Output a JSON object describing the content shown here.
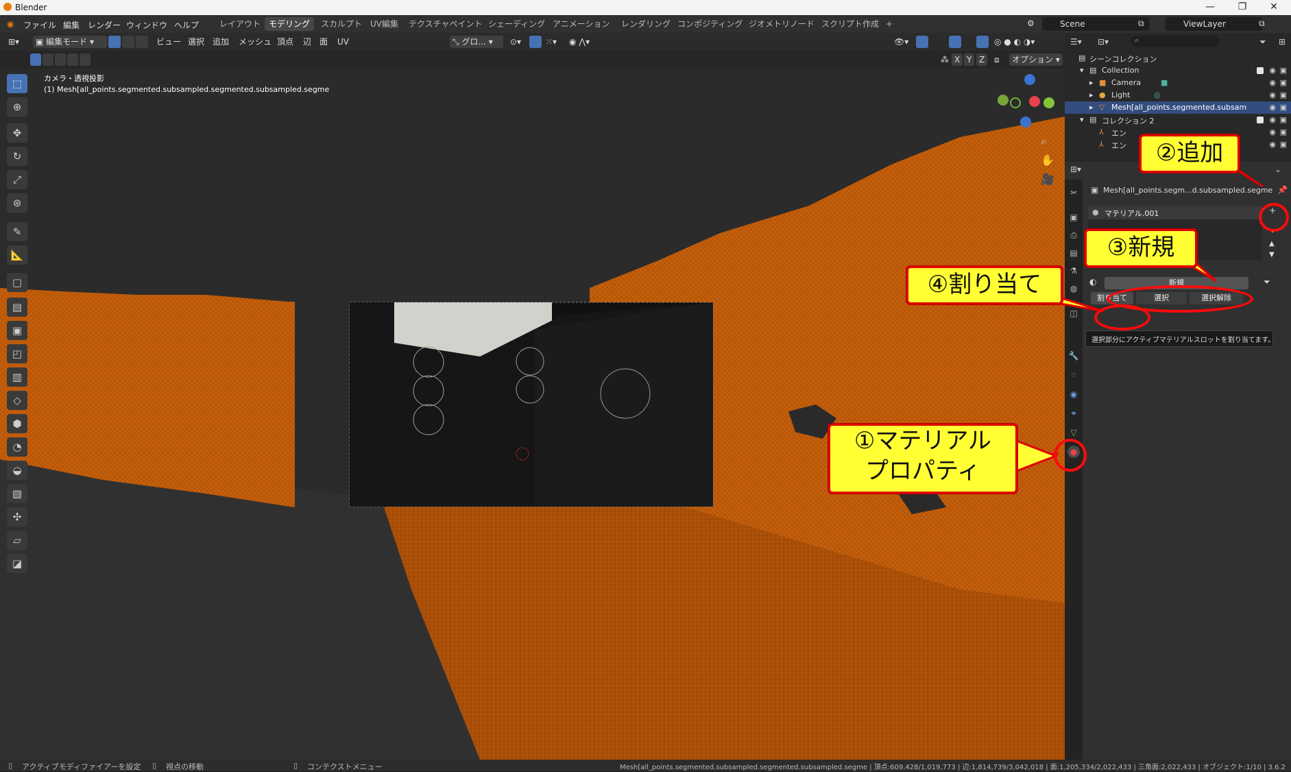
{
  "window": {
    "title": "Blender",
    "controls": [
      "—",
      "❐",
      "✕"
    ]
  },
  "menus": [
    "ファイル",
    "編集",
    "レンダー",
    "ウィンドウ",
    "ヘルプ"
  ],
  "workspaces": [
    "レイアウト",
    "モデリング",
    "スカルプト",
    "UV編集",
    "テクスチャペイント",
    "シェーディング",
    "アニメーション",
    "レンダリング",
    "コンポジティング",
    "ジオメトリノード",
    "スクリプト作成",
    "+"
  ],
  "active_workspace": "モデリング",
  "scene": "Scene",
  "view_layer": "ViewLayer",
  "viewport_header": {
    "mode": "編集モード",
    "menus": [
      "ビュー",
      "選択",
      "追加",
      "メッシュ",
      "頂点",
      "辺",
      "面",
      "UV"
    ],
    "transform": "グロ...",
    "axes": [
      "X",
      "Y",
      "Z"
    ],
    "options": "オプション"
  },
  "viewport": {
    "camera_label": "カメラ・透視投影",
    "object_label": "(1) Mesh[all_points.segmented.subsampled.segmented.subsampled.segme"
  },
  "outliner": {
    "root": "シーンコレクション",
    "rows": [
      {
        "label": "Collection",
        "indent": 1
      },
      {
        "label": "Camera",
        "indent": 2
      },
      {
        "label": "Light",
        "indent": 2
      },
      {
        "label": "Mesh[all_points.segmented.subsam",
        "indent": 2,
        "selected": true
      },
      {
        "label": "コレクション 2",
        "indent": 1
      },
      {
        "label": "エン",
        "indent": 2
      },
      {
        "label": "エン",
        "indent": 2
      }
    ]
  },
  "properties": {
    "object_name": "Mesh[all_points.segm...d.subsampled.segme",
    "material_slot": "マテリアル.001",
    "new_button": "新規",
    "assign_button": "割り当て",
    "select_button": "選択",
    "deselect_button": "選択解除",
    "tooltip": "選択部分にアクティブマテリアルスロットを割り当てます。"
  },
  "callouts": {
    "c1": "①マテリアル\nプロパティ",
    "c2": "②追加",
    "c3": "③新規",
    "c4": "④割り当て"
  },
  "status": {
    "left1": "アクティブモディファイアーを設定",
    "left2": "視点の移動",
    "left3": "コンテクストメニュー",
    "right": "Mesh[all_points.segmented.subsampled.segmented.subsampled.segme | 頂点:609,428/1,019,773 | 辺:1,814,739/3,042,018 | 面:1,205,334/2,022,433 | 三角面:2,022,433 | オブジェクト:1/10 | 3.6.2"
  },
  "colors": {
    "mesh_orange": "#c65f0b",
    "accent_blue": "#4772b3",
    "callout_yellow": "#ffff33",
    "callout_red": "#e00000"
  }
}
